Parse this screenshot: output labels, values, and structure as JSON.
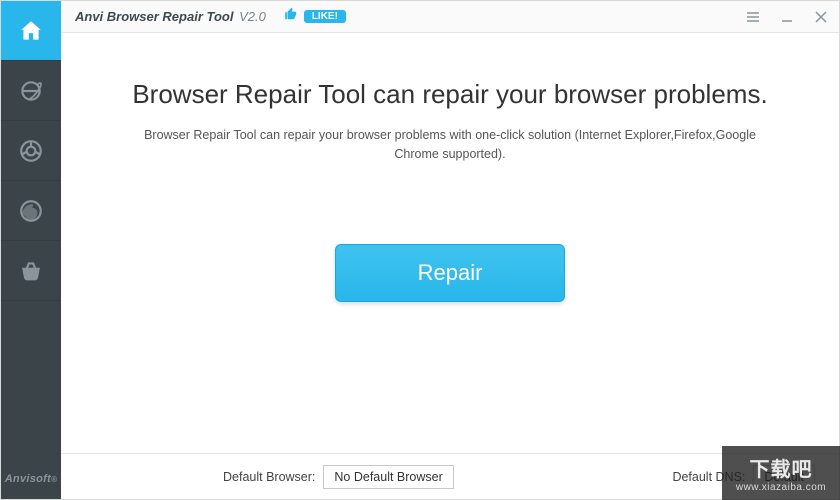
{
  "titlebar": {
    "app_name_bold": "Anvi Browser Repair Tool",
    "version": "V2.0",
    "like_label": "LIKE!"
  },
  "sidebar": {
    "items": [
      {
        "name": "home"
      },
      {
        "name": "internet-explorer"
      },
      {
        "name": "chrome"
      },
      {
        "name": "firefox"
      },
      {
        "name": "store"
      }
    ],
    "brand": "Anvisoft"
  },
  "content": {
    "headline": "Browser Repair Tool can repair your browser problems.",
    "subhead": "Browser Repair Tool can repair your browser problems with one-click solution (Internet Explorer,Firefox,Google Chrome supported).",
    "repair_button": "Repair"
  },
  "footer": {
    "default_browser_label": "Default Browser:",
    "default_browser_value": "No Default Browser",
    "default_dns_label": "Default DNS:",
    "default_dns_value": "Default"
  },
  "watermark": {
    "top": "下载吧",
    "bottom": "www.xiazaiba.com"
  }
}
